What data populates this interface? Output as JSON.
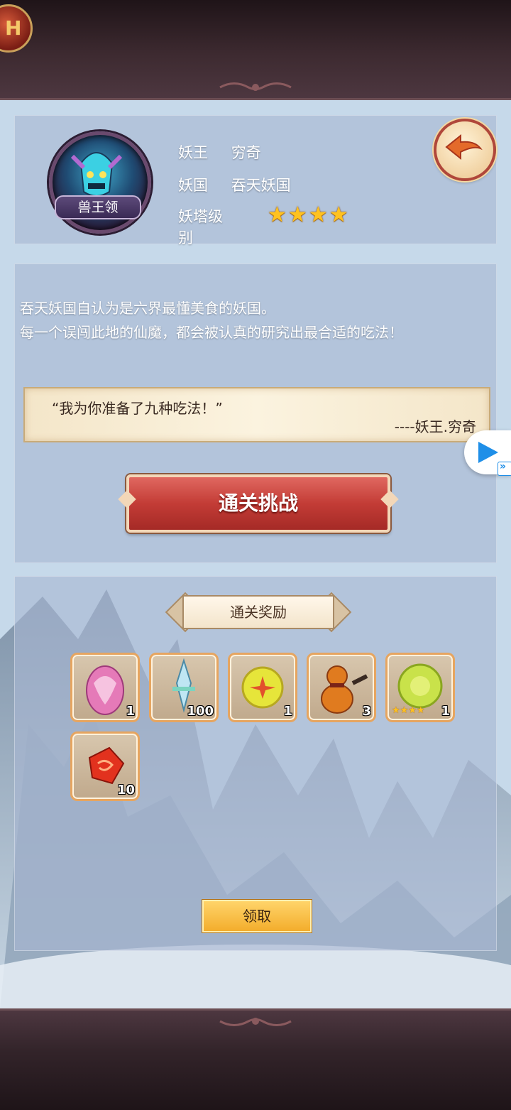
{
  "colors": {
    "accent_red": "#c33c36",
    "gold_star": "#ffc21f",
    "claim_gold": "#f3ad2c",
    "panel_tint": "#a8b6d2"
  },
  "header": {
    "corner_badge_glyph": "H"
  },
  "demon_info": {
    "avatar_label": "兽王领",
    "rows": [
      {
        "key": "妖王",
        "value": "穷奇"
      },
      {
        "key": "妖国",
        "value": "吞天妖国"
      },
      {
        "key": "妖塔级别",
        "value": ""
      }
    ],
    "tower_level_stars": 4
  },
  "back_icon": "back-arrow-icon",
  "story": {
    "lines": [
      "吞天妖国自认为是六界最懂美食的妖国。",
      "每一个误闯此地的仙魔，都会被认真的研究出最合适的吃法！"
    ],
    "quote": "“我为你准备了九种吃法！”",
    "quote_author": "----妖王.穷奇",
    "challenge_label": "通关挑战"
  },
  "rewards": {
    "title": "通关奖励",
    "items": [
      {
        "icon": "pink-dragon-egg-icon",
        "count": "1"
      },
      {
        "icon": "crystal-sword-icon",
        "count": "100"
      },
      {
        "icon": "yellow-orb-icon",
        "count": "1"
      },
      {
        "icon": "gourd-icon",
        "count": "3"
      },
      {
        "icon": "star-orb-icon",
        "count": "1",
        "stars": 4
      },
      {
        "icon": "red-gem-icon",
        "count": "10"
      }
    ],
    "claim_label": "领取"
  },
  "side_controls": {
    "play_icon": "play-icon",
    "fast_forward_icon": "fast-forward-icon",
    "fast_forward_glyph": "»"
  }
}
